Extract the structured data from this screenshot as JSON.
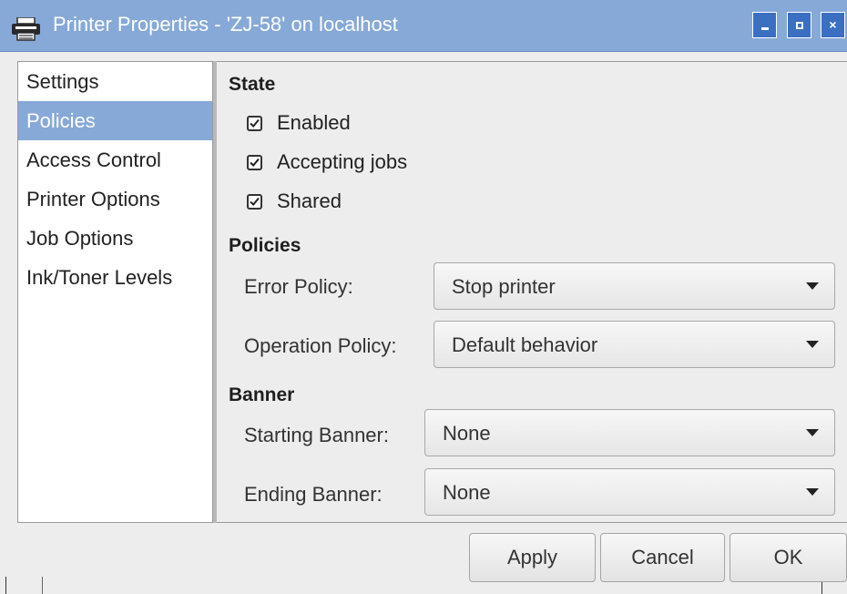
{
  "window": {
    "title": "Printer Properties - 'ZJ-58' on localhost",
    "icon": "printer-icon",
    "controls": {
      "minimize": "minimize-icon",
      "maximize": "maximize-icon",
      "close": "×"
    }
  },
  "sidebar": {
    "items": [
      {
        "label": "Settings",
        "selected": false
      },
      {
        "label": "Policies",
        "selected": true
      },
      {
        "label": "Access Control",
        "selected": false
      },
      {
        "label": "Printer Options",
        "selected": false
      },
      {
        "label": "Job Options",
        "selected": false
      },
      {
        "label": "Ink/Toner Levels",
        "selected": false
      }
    ]
  },
  "state": {
    "heading": "State",
    "enabled": {
      "label": "Enabled",
      "checked": true
    },
    "accepting": {
      "label": "Accepting jobs",
      "checked": true
    },
    "shared": {
      "label": "Shared",
      "checked": true
    }
  },
  "policies": {
    "heading": "Policies",
    "error_policy": {
      "label": "Error Policy:",
      "value": "Stop printer"
    },
    "operation_policy": {
      "label": "Operation Policy:",
      "value": "Default behavior"
    }
  },
  "banner": {
    "heading": "Banner",
    "starting": {
      "label": "Starting Banner:",
      "value": "None"
    },
    "ending": {
      "label": "Ending Banner:",
      "value": "None"
    }
  },
  "buttons": {
    "apply": "Apply",
    "cancel": "Cancel",
    "ok": "OK"
  },
  "colors": {
    "titlebar": "#87a9d8",
    "selection": "#87a9d8",
    "window_buttons": "#3b6fc2",
    "window_bg": "#ededed"
  }
}
